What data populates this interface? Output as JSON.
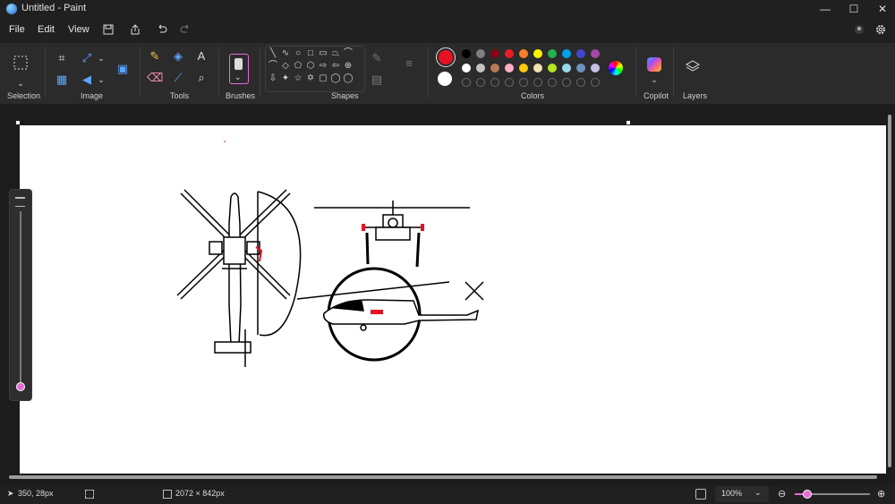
{
  "window": {
    "title": "Untitled - Paint",
    "minimize": "—",
    "maximize": "☐",
    "close": "✕"
  },
  "menu": {
    "file": "File",
    "edit": "Edit",
    "view": "View"
  },
  "ribbon": {
    "groups": {
      "selection": "Selection",
      "image": "Image",
      "tools": "Tools",
      "brushes": "Brushes",
      "shapes": "Shapes",
      "colors": "Colors",
      "copilot": "Copilot",
      "layers": "Layers"
    },
    "shapes": [
      "╲",
      "∿",
      "○",
      "□",
      "▭",
      "⏢",
      "⌒",
      "◇",
      "⬠",
      "⬡",
      "⇨",
      "⇦",
      "⊕",
      "✧",
      "☆",
      "✡",
      "▢",
      "◯",
      "⇩",
      "✦",
      "✡",
      "☆",
      "◯",
      "◯",
      "♡",
      "⌒"
    ],
    "colors": {
      "primary": "#e81123",
      "secondary": "#ffffff",
      "row1": [
        "#000000",
        "#7f7f7f",
        "#880015",
        "#ed1c24",
        "#ff7f27",
        "#fff200",
        "#22b14c",
        "#00a2e8",
        "#3f48cc",
        "#a349a4"
      ],
      "row2": [
        "#ffffff",
        "#c3c3c3",
        "#b97a57",
        "#ffaec9",
        "#ffc90e",
        "#efe4b0",
        "#b5e61d",
        "#99d9ea",
        "#7092be",
        "#c8bfe7"
      ]
    }
  },
  "status": {
    "cursor": "350, 28px",
    "canvas_size": "2072 × 842px",
    "zoom": "100%"
  }
}
